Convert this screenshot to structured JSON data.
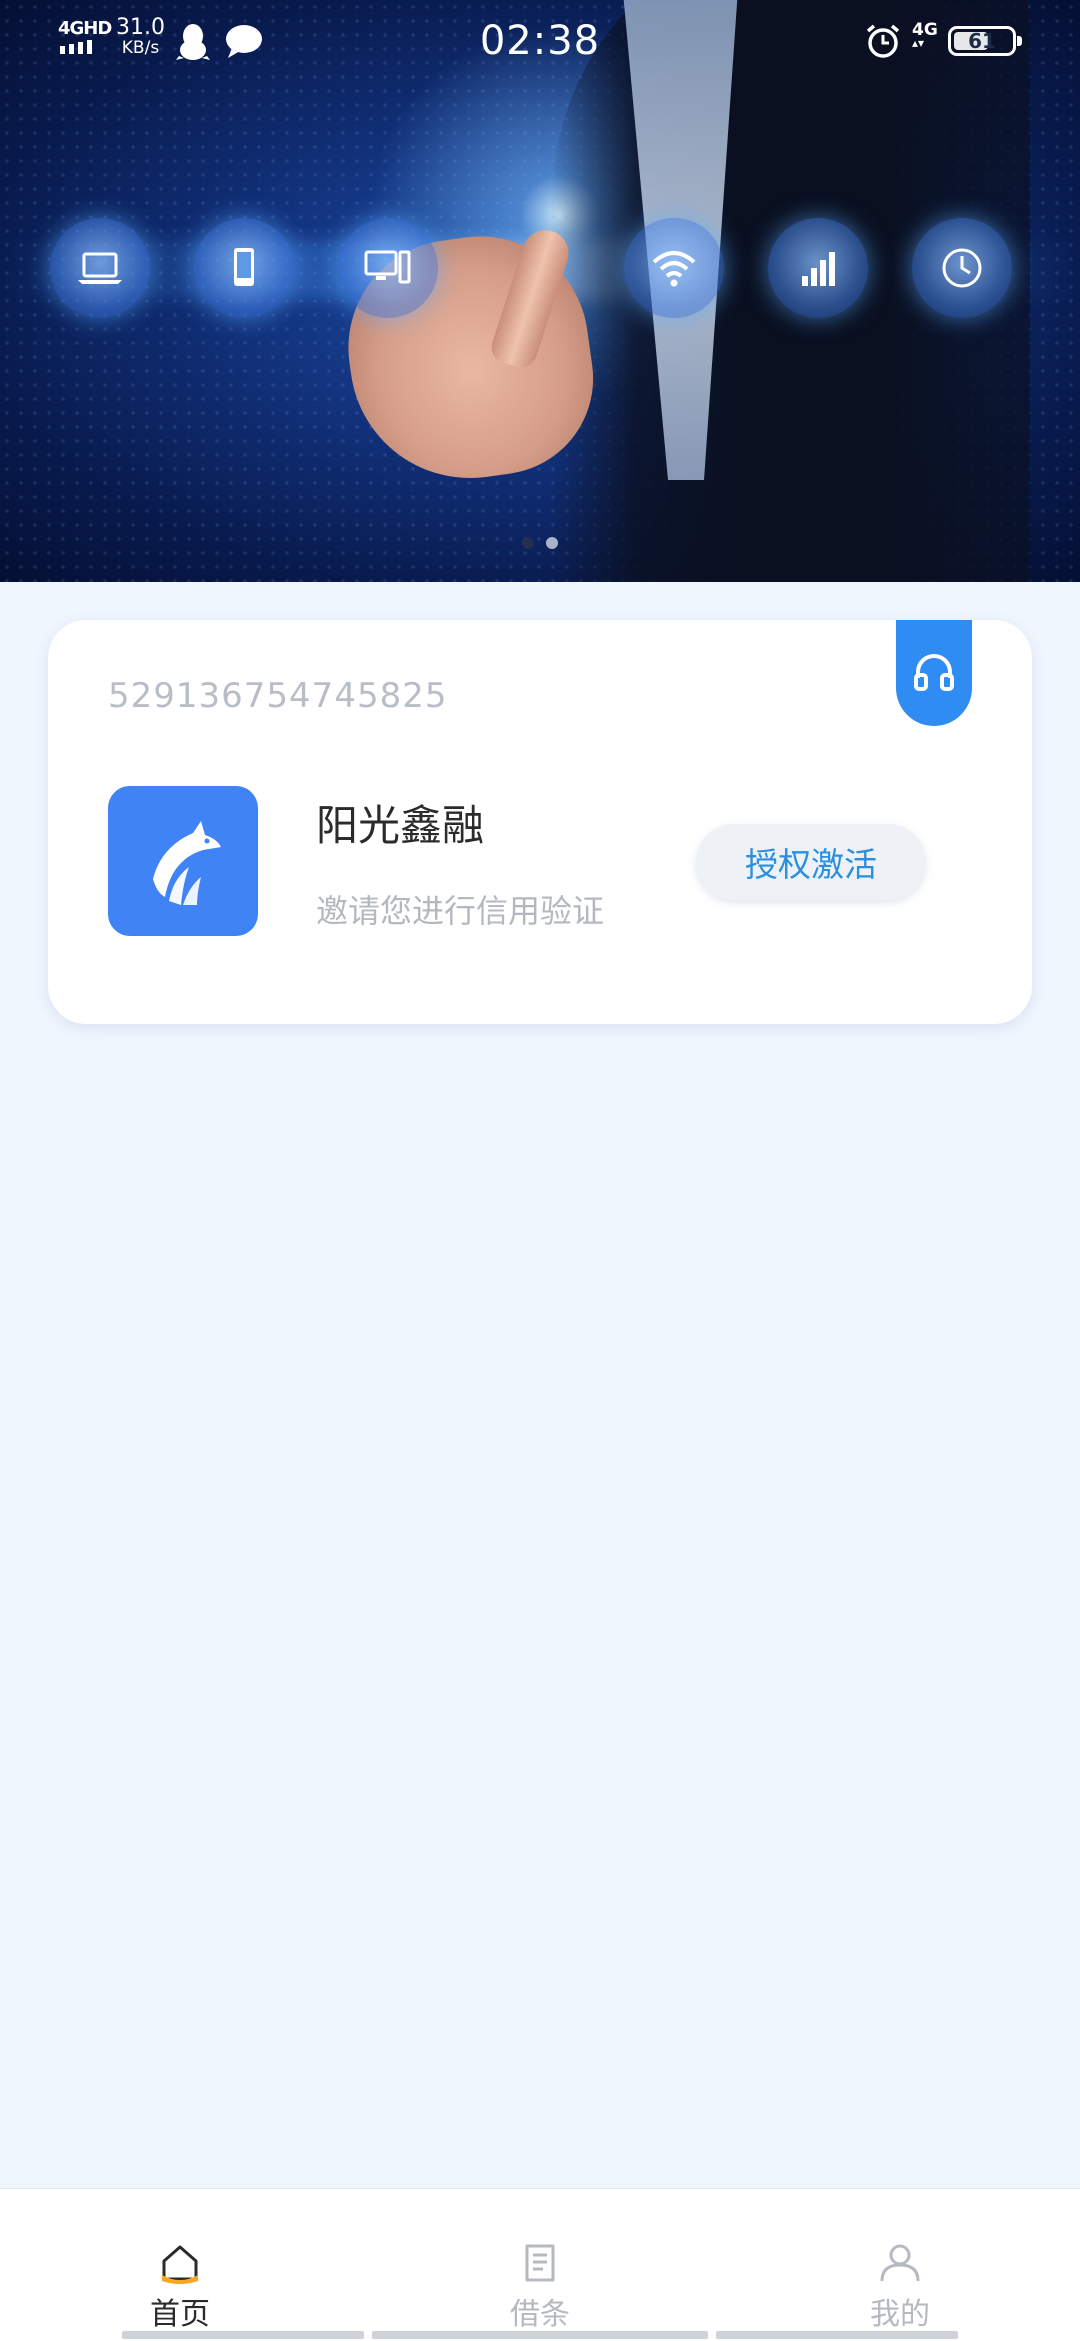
{
  "status_bar": {
    "network": "4GHD",
    "speed_value": "31.0",
    "speed_unit": "KB/s",
    "time": "02:38",
    "network_right": "4G",
    "battery": "61",
    "battery_level": 0.61
  },
  "banner": {
    "slide_count": 2,
    "active_slide": 2
  },
  "card": {
    "id_number": "529136754745825",
    "app_name": "阳光鑫融",
    "app_desc": "邀请您进行信用验证",
    "activate_label": "授权激活",
    "logo_color": "#3f83f5"
  },
  "nav": {
    "items": [
      {
        "label": "首页",
        "icon": "home-icon",
        "active": true
      },
      {
        "label": "借条",
        "icon": "document-icon",
        "active": false
      },
      {
        "label": "我的",
        "icon": "user-icon",
        "active": false
      }
    ]
  },
  "colors": {
    "accent": "#2f8cf2",
    "page_bg": "#f0f6fe",
    "active_icon_fill": "#f5a623"
  }
}
